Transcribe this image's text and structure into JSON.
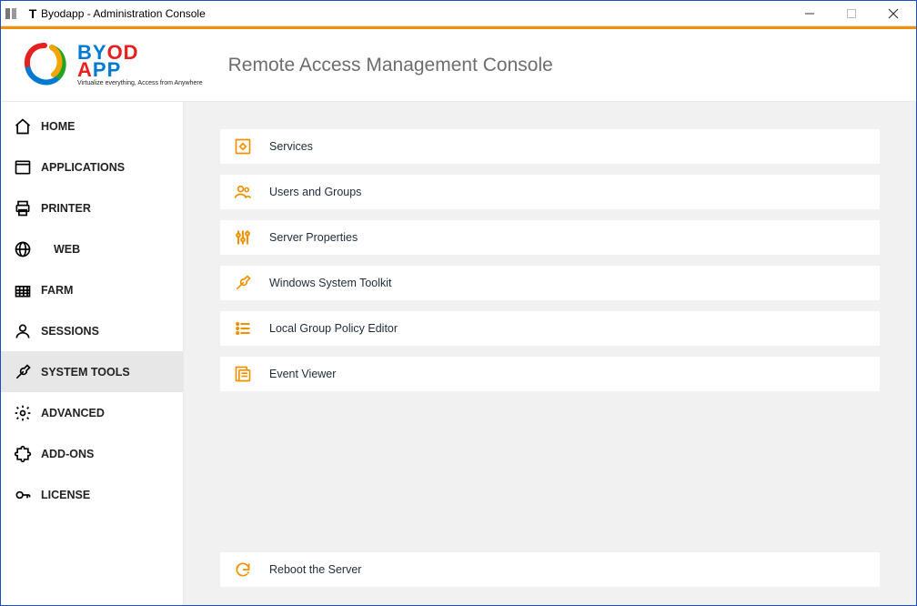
{
  "window_title": "Byodapp - Administration Console",
  "logo": {
    "line1_a": "BY",
    "line1_b": "OD",
    "line2_a": "A",
    "line2_b": "PP",
    "tagline": "Virtualize everything, Access from Anywhere"
  },
  "page_title": "Remote Access Management Console",
  "sidebar": {
    "items": [
      {
        "label": "HOME"
      },
      {
        "label": "APPLICATIONS"
      },
      {
        "label": "PRINTER"
      },
      {
        "label": "WEB"
      },
      {
        "label": "FARM"
      },
      {
        "label": "SESSIONS"
      },
      {
        "label": "SYSTEM TOOLS"
      },
      {
        "label": "ADVANCED"
      },
      {
        "label": "ADD-ONS"
      },
      {
        "label": "LICENSE"
      }
    ]
  },
  "tools": {
    "items": [
      {
        "label": "Services"
      },
      {
        "label": "Users and Groups"
      },
      {
        "label": "Server Properties"
      },
      {
        "label": "Windows System Toolkit"
      },
      {
        "label": "Local Group Policy Editor"
      },
      {
        "label": "Event Viewer"
      }
    ],
    "footer": {
      "label": "Reboot the Server"
    }
  },
  "colors": {
    "accent": "#f19100",
    "brand_blue": "#0079d0",
    "brand_red": "#e62020"
  }
}
